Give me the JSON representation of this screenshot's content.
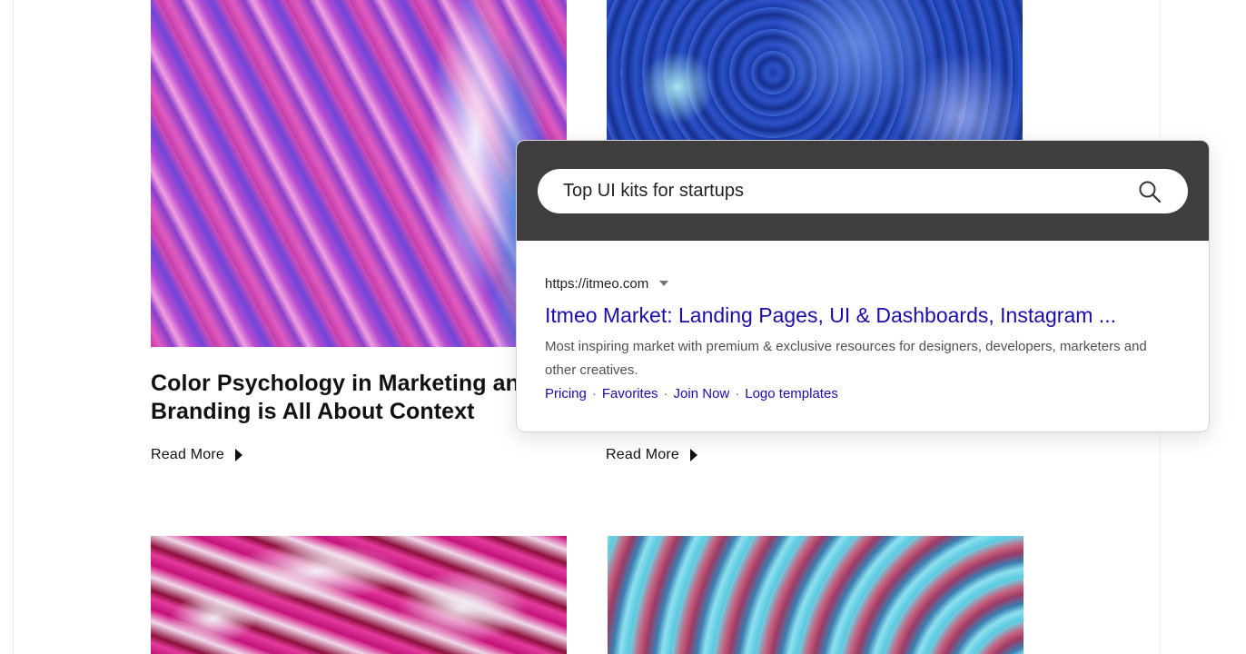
{
  "posts": [
    {
      "title_line1": "Color Psychology in Marketing and",
      "title_line2": "Branding is All About Context",
      "read_more": "Read More"
    },
    {
      "read_more": "Read More"
    }
  ],
  "search": {
    "query": "Top UI kits for startups",
    "icon": "search-icon"
  },
  "result": {
    "url": "https://itmeo.com",
    "title": "Itmeo Market: Landing Pages, UI & Dashboards, Instagram ...",
    "snippet": "Most inspiring market with premium & exclusive resources for designers, developers, marketers and other creatives.",
    "sitelinks": [
      "Pricing",
      "Favorites",
      "Join Now",
      "Logo templates"
    ],
    "separator": "·"
  },
  "colors": {
    "link": "#1a0dab",
    "search_header": "#3f3d3d",
    "snippet": "#4d5156"
  }
}
